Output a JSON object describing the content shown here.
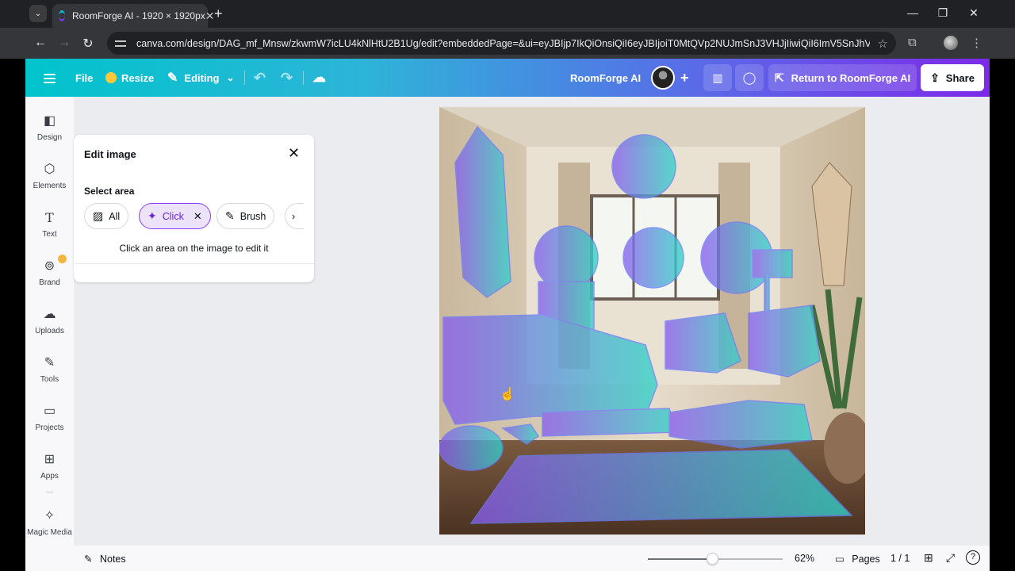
{
  "browser": {
    "tab_title": "RoomForge AI - 1920 × 1920px",
    "url": "canva.com/design/DAG_mf_Mnsw/zkwmW7icLU4kNlHtU2B1Ug/edit?embeddedPage=&ui=eyJBIjp7IkQiOnsiQiI6eyJBIjoiT0MtQVp2NUJmSnJ3VHJjIiwiQiI6ImV5SnJhV1FpT2lJeFl6..."
  },
  "header": {
    "file_label": "File",
    "resize_label": "Resize",
    "editing_label": "Editing",
    "design_title": "RoomForge AI",
    "return_label": "Return to RoomForge AI",
    "share_label": "Share"
  },
  "sidebar": {
    "items": [
      {
        "label": "Design",
        "icon": "design-icon"
      },
      {
        "label": "Elements",
        "icon": "elements-icon"
      },
      {
        "label": "Text",
        "icon": "text-icon"
      },
      {
        "label": "Brand",
        "icon": "brand-icon"
      },
      {
        "label": "Uploads",
        "icon": "uploads-icon"
      },
      {
        "label": "Tools",
        "icon": "tools-icon"
      },
      {
        "label": "Projects",
        "icon": "projects-icon"
      },
      {
        "label": "Apps",
        "icon": "apps-icon"
      },
      {
        "label": "Magic Media",
        "icon": "magic-media-icon"
      }
    ]
  },
  "edit_panel": {
    "title": "Edit image",
    "select_area_label": "Select area",
    "modes": [
      {
        "label": "All",
        "active": false
      },
      {
        "label": "Click",
        "active": true
      },
      {
        "label": "Brush",
        "active": false
      }
    ],
    "hint": "Click an area on the image to edit it"
  },
  "footer": {
    "notes_label": "Notes",
    "zoom_percent": "62%",
    "zoom_slider_level": 0.48,
    "pages_label": "Pages",
    "page_count": "1 / 1"
  },
  "colors": {
    "header_gradient_start": "#00c4cc",
    "header_gradient_end": "#7d2ae8",
    "selection_overlay_start": "#8a5cf0",
    "selection_overlay_end": "#2fd3c8",
    "active_mode_bg": "#ece3fa",
    "active_mode_border": "#8b3dff"
  }
}
